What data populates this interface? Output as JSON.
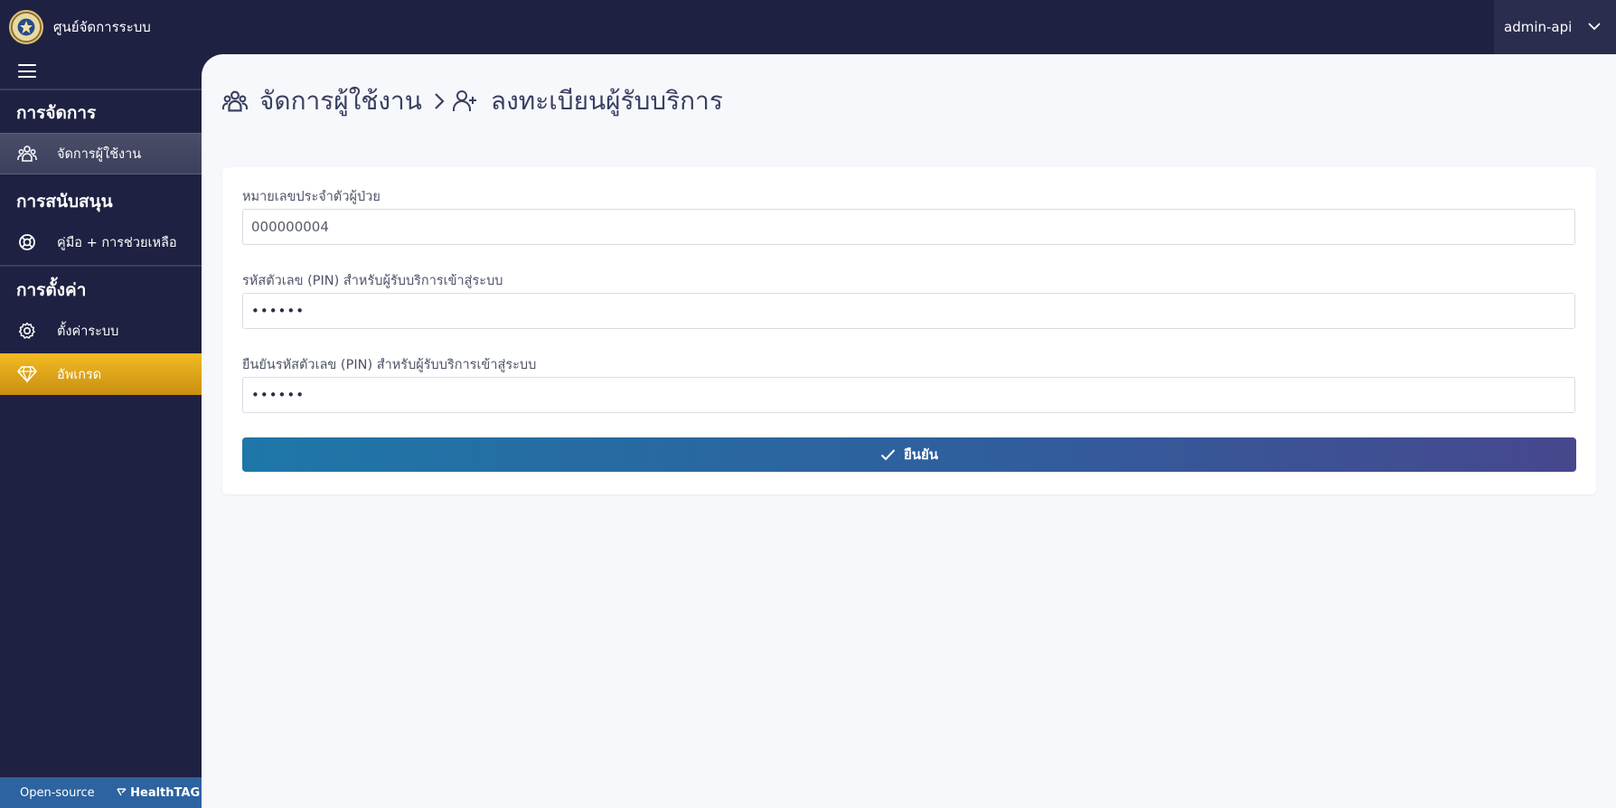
{
  "header": {
    "app_title": "ศูนย์จัดการระบบ",
    "user_name": "admin-api",
    "logo_icon": "seal-logo-icon",
    "menu_icon": "chevron-down-icon"
  },
  "sidebar": {
    "toggle_icon": "hamburger-icon",
    "sections": [
      {
        "heading": "การจัดการ",
        "items": [
          {
            "label": "จัดการผู้ใช้งาน",
            "icon": "users-icon",
            "active": true
          }
        ]
      },
      {
        "heading": "การสนับสนุน",
        "items": [
          {
            "label": "คู่มือ + การช่วยเหลือ",
            "icon": "lifebuoy-icon",
            "active": false
          }
        ]
      },
      {
        "heading": "การตั้งค่า",
        "items": [
          {
            "label": "ตั้งค่าระบบ",
            "icon": "gear-icon",
            "active": false
          },
          {
            "label": "อัพเกรด",
            "icon": "diamond-icon",
            "active": false
          }
        ]
      }
    ],
    "footer": {
      "left": "Open-source",
      "right": "HealthTAG",
      "right_icon": "healthtag-icon"
    }
  },
  "breadcrumb": {
    "parent": "จัดการผู้ใช้งาน",
    "parent_icon": "users-icon",
    "separator_icon": "chevron-right-icon",
    "current": "ลงทะเบียนผู้รับบริการ",
    "current_icon": "user-plus-icon"
  },
  "form": {
    "patient_id_label": "หมายเลขประจำตัวผู้ป่วย",
    "patient_id_value": "000000004",
    "pin_label": "รหัสตัวเลข (PIN) สำหรับผู้รับบริการเข้าสู่ระบบ",
    "pin_value": "••••••",
    "pin_confirm_label": "ยืนยันรหัสตัวเลข (PIN) สำหรับผู้รับบริการเข้าสู่ระบบ",
    "pin_confirm_value": "••••••",
    "submit_label": "ยืนยัน",
    "submit_icon": "check-icon"
  },
  "colors": {
    "sidebar_bg": "#1f2142",
    "main_bg": "#f6f8fc",
    "active_item_bg": "#45485f",
    "upgrade_bg": "#e9ae1c",
    "footer_bg": "#2c63a0",
    "button_gradient_start": "#1e77a8",
    "button_gradient_end": "#47478e"
  }
}
